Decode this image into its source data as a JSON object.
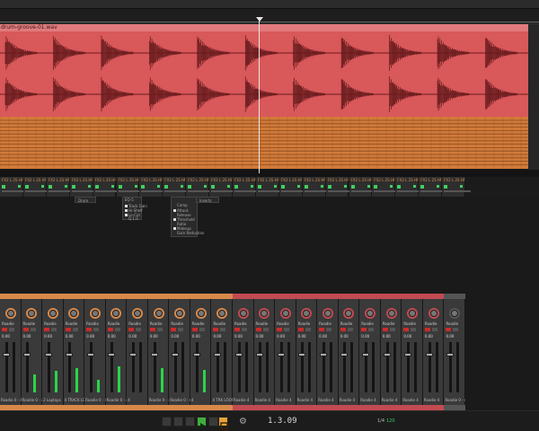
{
  "arrangement": {
    "clip_name": "drum-groove-01.wav"
  },
  "devices": [
    {
      "label": "FX2 L 2S HF"
    },
    {
      "label": "FX2 L 2S HF"
    },
    {
      "label": "FX2 L 2S HF"
    },
    {
      "label": "FX2 L 2S HF"
    },
    {
      "label": "FX2 L 2S HF"
    },
    {
      "label": "FX2 L 2S HF"
    },
    {
      "label": "FX2 L 2S HF"
    },
    {
      "label": "FX2 L 2S HF"
    },
    {
      "label": "FX2 L 2S HF"
    },
    {
      "label": "FX2 L 2S HF"
    },
    {
      "label": "FX2 L 2S HF"
    },
    {
      "label": "FX2 L 2S HF"
    },
    {
      "label": "FX2 L 2S HF"
    },
    {
      "label": "FX2 L 2S HF"
    },
    {
      "label": "FX2 L 2S HF"
    },
    {
      "label": "FX2 L 2S HF"
    },
    {
      "label": "FX2 L 2S HF"
    },
    {
      "label": "FX2 L 2S HF"
    },
    {
      "label": "FX2 L 2S HF"
    },
    {
      "label": "FX2 L 2S HF"
    }
  ],
  "popups": {
    "drum": {
      "label": "Drum"
    },
    "eq": {
      "label": "EQ-5",
      "items": [
        "Track Gain",
        "Hi-Shelf",
        "Lo-Cut",
        "Q 1.0"
      ]
    },
    "comp": {
      "label": "Comp",
      "items": [
        "Attack",
        "Release",
        "Threshold",
        "Ratio",
        "Makeup",
        "Gain Reduction"
      ]
    },
    "inserts": {
      "label": "Inserts"
    }
  },
  "mixer": {
    "channels": [
      {
        "name": "Roadie 0 - 4",
        "value": "0.00",
        "meter": 0.0,
        "color": "#d8894a",
        "footer": "Roadie 0 - 4"
      },
      {
        "name": "Roadie 0 - 4",
        "value": "0.00",
        "meter": 0.35,
        "color": "#d8894a",
        "footer": "Roadie 0 - 4"
      },
      {
        "name": "Roadie 0 - 4",
        "value": "0.00",
        "meter": 0.42,
        "color": "#d8894a",
        "footer": "2 Laptops"
      },
      {
        "name": "Roadie 0 - 4",
        "value": "0.00",
        "meter": 0.48,
        "color": "#d8894a",
        "footer": "4 TRACK LOOP"
      },
      {
        "name": "Roadie 0 - 4",
        "value": "0.00",
        "meter": 0.25,
        "color": "#d8894a",
        "footer": "Roadie 0 - 4"
      },
      {
        "name": "Roadie 0 - 4",
        "value": "0.00",
        "meter": 0.52,
        "color": "#d8894a",
        "footer": "Roadie 0 - 4"
      },
      {
        "name": "Roadie 0 - 4",
        "value": "0.00",
        "meter": 0.0,
        "color": "#d8894a",
        "footer": "4"
      },
      {
        "name": "Roadie 0 - 4",
        "value": "0.00",
        "meter": 0.48,
        "color": "#d8894a",
        "footer": "Roadie 0 - 4"
      },
      {
        "name": "Roadie 0 - 4",
        "value": "0.00",
        "meter": 0.0,
        "color": "#d8894a",
        "footer": "Roadie 0 - 4"
      },
      {
        "name": "Roadie 0 - 4",
        "value": "0.00",
        "meter": 0.45,
        "color": "#d8894a",
        "footer": "4"
      },
      {
        "name": "Roadie 0 - 4",
        "value": "0.00",
        "meter": 0.0,
        "color": "#d8894a",
        "footer": "4 TRK LOOP"
      },
      {
        "name": "Roadie 0 - 4",
        "value": "0.00",
        "meter": 0.0,
        "color": "#c24a52",
        "footer": "Roadie 4"
      },
      {
        "name": "Roadie 0 - 4",
        "value": "0.00",
        "meter": 0.0,
        "color": "#c24a52",
        "footer": "Roadie 4"
      },
      {
        "name": "Roadie 0 - 4",
        "value": "0.00",
        "meter": 0.0,
        "color": "#c24a52",
        "footer": "Roadie 4"
      },
      {
        "name": "Roadie 0 - 4",
        "value": "0.00",
        "meter": 0.0,
        "color": "#c24a52",
        "footer": "Roadie 4"
      },
      {
        "name": "Roadie 0 - 4",
        "value": "0.00",
        "meter": 0.0,
        "color": "#c24a52",
        "footer": "Roadie 4"
      },
      {
        "name": "Roadie 0 - 4",
        "value": "0.00",
        "meter": 0.0,
        "color": "#c24a52",
        "footer": "Roadie 4"
      },
      {
        "name": "Roadie 0 - 4",
        "value": "0.00",
        "meter": 0.0,
        "color": "#c24a52",
        "footer": "Roadie 4"
      },
      {
        "name": "Roadie 0 - 4",
        "value": "0.00",
        "meter": 0.0,
        "color": "#c24a52",
        "footer": "Roadie 4"
      },
      {
        "name": "Roadie 0 - 4",
        "value": "0.00",
        "meter": 0.0,
        "color": "#c24a52",
        "footer": "Roadie 4"
      },
      {
        "name": "Roadie 0 - 4",
        "value": "0.00",
        "meter": 0.0,
        "color": "#c24a52",
        "footer": "Roadie 4"
      },
      {
        "name": "Roadie 0 - 4",
        "value": "0.00",
        "meter": 0.0,
        "color": "#555555",
        "footer": "Roadie 0 - 4"
      }
    ]
  },
  "transport": {
    "time": "1.3.09",
    "tempo_label": "1/4",
    "tempo_value": "120"
  },
  "colors": {
    "audio_clip": "#d9585a",
    "midi_clip": "#d17a3a",
    "meter_green": "#2bd44a",
    "play_green": "#3fae3f",
    "loop_orange": "#e8a23a"
  },
  "icons": {
    "play": "play-icon",
    "rewind": "rewind-icon",
    "forward": "forward-icon",
    "loop": "loop-icon",
    "settings": "gear-icon"
  }
}
